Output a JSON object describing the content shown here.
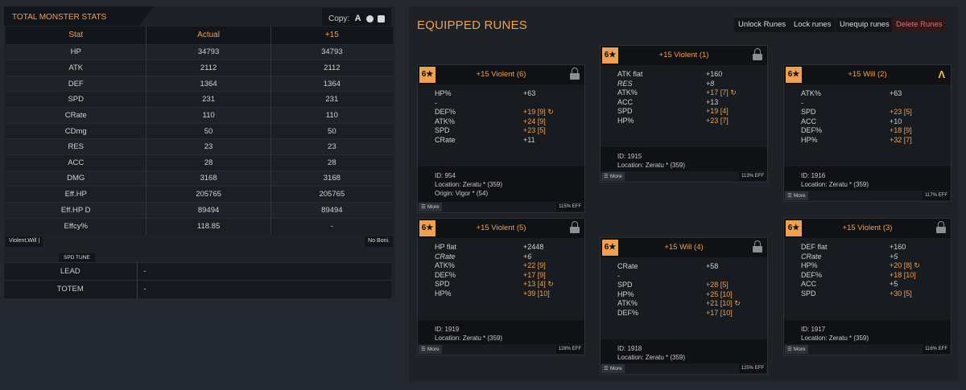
{
  "left": {
    "title": "TOTAL MONSTER STATS",
    "copy_label": "Copy:",
    "table": {
      "headers": [
        "Stat",
        "Actual",
        "+15"
      ],
      "rows": [
        [
          "HP",
          "34793",
          "34793"
        ],
        [
          "ATK",
          "2112",
          "2112"
        ],
        [
          "DEF",
          "1364",
          "1364"
        ],
        [
          "SPD",
          "231",
          "231"
        ],
        [
          "CRate",
          "110",
          "110"
        ],
        [
          "CDmg",
          "50",
          "50"
        ],
        [
          "RES",
          "23",
          "23"
        ],
        [
          "ACC",
          "28",
          "28"
        ],
        [
          "DMG",
          "3168",
          "3168"
        ],
        [
          "Eff.HP",
          "205765",
          "205765"
        ],
        [
          "Eff.HP D",
          "89494",
          "89494"
        ],
        [
          "Effcy%",
          "118.85",
          "-"
        ]
      ]
    },
    "set_badge": "Violent,Will |",
    "noboni_badge": "No Boni.",
    "spd_tune": "SPD TUNE",
    "lead_totem": [
      {
        "label": "LEAD",
        "value": "-"
      },
      {
        "label": "TOTEM",
        "value": "-"
      }
    ]
  },
  "right": {
    "title": "EQUIPPED RUNES",
    "buttons": {
      "unlock": "Unlock Runes",
      "lock": "Lock runes",
      "unequip": "Unequip runes",
      "delete": "Delete Runes"
    },
    "runes": [
      {
        "grade": "6★",
        "title": "+15 Violent (6)",
        "stats": [
          {
            "name": "HP%",
            "value": "+63"
          },
          {
            "name": "-",
            "value": ""
          },
          {
            "name": "DEF%",
            "value": "+19 [9] ↻",
            "hl": true
          },
          {
            "name": "ATK%",
            "value": "+24 [9]",
            "hl": true
          },
          {
            "name": "SPD",
            "value": "+23 [5]",
            "hl": true
          },
          {
            "name": "CRate",
            "value": "+11"
          }
        ],
        "info": [
          "ID: 954",
          "Location: Zeratu * (359)",
          "Origin: Vigor * (54)"
        ],
        "more": "More",
        "eff": "115% EFF"
      },
      {
        "grade": "6★",
        "title": "+15 Violent (1)",
        "stats": [
          {
            "name": "ATK flat",
            "value": "+160"
          },
          {
            "name": "RES",
            "value": "+8",
            "it": true
          },
          {
            "name": "ATK%",
            "value": "+17 [7] ↻",
            "hl": true
          },
          {
            "name": "ACC",
            "value": "+13"
          },
          {
            "name": "SPD",
            "value": "+19 [4]",
            "hl": true
          },
          {
            "name": "HP%",
            "value": "+23 [7]",
            "hl": true
          }
        ],
        "info": [
          "ID: 1915",
          "Location: Zeratu * (359)"
        ],
        "more": "More",
        "eff": "113% EFF"
      },
      {
        "grade": "6★",
        "title": "+15 Will (2)",
        "ancient": true,
        "stats": [
          {
            "name": "ATK%",
            "value": "+63"
          },
          {
            "name": "-",
            "value": ""
          },
          {
            "name": "SPD",
            "value": "+23 [5]",
            "hl": true
          },
          {
            "name": "ACC",
            "value": "+10"
          },
          {
            "name": "DEF%",
            "value": "+18 [9]",
            "hl": true
          },
          {
            "name": "HP%",
            "value": "+32 [7]",
            "hl": true
          }
        ],
        "info": [
          "ID: 1916",
          "Location: Zeratu * (359)"
        ],
        "more": "More",
        "eff": "117% EFF"
      },
      {
        "grade": "6★",
        "title": "+15 Violent (5)",
        "stats": [
          {
            "name": "HP flat",
            "value": "+2448"
          },
          {
            "name": "CRate",
            "value": "+6",
            "it": true
          },
          {
            "name": "ATK%",
            "value": "+22 [9]",
            "hl": true
          },
          {
            "name": "DEF%",
            "value": "+17 [9]",
            "hl": true
          },
          {
            "name": "SPD",
            "value": "+13 [4] ↻",
            "hl": true
          },
          {
            "name": "HP%",
            "value": "+39 [10]",
            "hl": true
          }
        ],
        "info": [
          "ID: 1919",
          "Location: Zeratu * (359)"
        ],
        "more": "More",
        "eff": "128% EFF"
      },
      {
        "grade": "6★",
        "title": "+15 Will (4)",
        "stats": [
          {
            "name": "CRate",
            "value": "+58"
          },
          {
            "name": "-",
            "value": ""
          },
          {
            "name": "SPD",
            "value": "+28 [5]",
            "hl": true
          },
          {
            "name": "HP%",
            "value": "+25 [10]",
            "hl": true
          },
          {
            "name": "ATK%",
            "value": "+21 [10] ↻",
            "hl": true
          },
          {
            "name": "DEF%",
            "value": "+17 [10]",
            "hl": true
          }
        ],
        "info": [
          "ID: 1918",
          "Location: Zeratu * (359)"
        ],
        "more": "More",
        "eff": "125% EFF"
      },
      {
        "grade": "6★",
        "title": "+15 Violent (3)",
        "stats": [
          {
            "name": "DEF flat",
            "value": "+160"
          },
          {
            "name": "CRate",
            "value": "+5",
            "it": true
          },
          {
            "name": "HP%",
            "value": "+20 [8] ↻",
            "hl": true
          },
          {
            "name": "DEF%",
            "value": "+18 [10]",
            "hl": true
          },
          {
            "name": "ACC",
            "value": "+5"
          },
          {
            "name": "SPD",
            "value": "+30 [5]",
            "hl": true
          }
        ],
        "info": [
          "ID: 1917",
          "Location: Zeratu * (359)"
        ],
        "more": "More",
        "eff": "116% EFF"
      }
    ]
  },
  "colors": {
    "accent": "#f0a050",
    "panel": "#1e2227",
    "background": "#232830",
    "delete": "#e07070"
  }
}
